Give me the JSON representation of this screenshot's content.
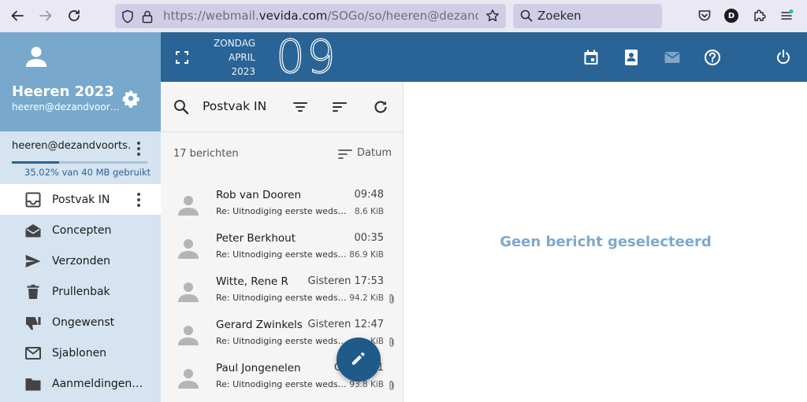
{
  "browser": {
    "url_prefix": "https://webmail.",
    "url_domain": "vevida.com",
    "url_suffix": "/SOGo/so/heeren@dezandvoortse.n",
    "search_placeholder": "Zoeken",
    "profile_initial": "D"
  },
  "header": {
    "weekday": "ZONDAG",
    "month": "APRIL",
    "year": "2023",
    "day": "09"
  },
  "sidebar": {
    "user_name": "Heeren 2023",
    "user_email": "heeren@dezandvoor…",
    "account": "heeren@dezandvoorts…",
    "quota_fraction": 0.3502,
    "quota_text": "35.02% van 40 MB gebruikt",
    "folders": [
      {
        "label": "Postvak IN",
        "icon": "inbox-icon"
      },
      {
        "label": "Concepten",
        "icon": "drafts-icon"
      },
      {
        "label": "Verzonden",
        "icon": "send-icon"
      },
      {
        "label": "Prullenbak",
        "icon": "trash-icon"
      },
      {
        "label": "Ongewenst",
        "icon": "thumb-down-icon"
      },
      {
        "label": "Sjablonen",
        "icon": "mail-icon"
      },
      {
        "label": "Aanmeldingen…",
        "icon": "folder-icon"
      }
    ]
  },
  "list": {
    "title": "Postvak IN",
    "count": "17 berichten",
    "sort_label": "Datum",
    "messages": [
      {
        "sender": "Rob van Dooren",
        "time": "09:48",
        "subject": "Re: Uitnodiging eerste wedstr…",
        "size": "8.6 KiB",
        "attachment": false
      },
      {
        "sender": "Peter Berkhout",
        "time": "00:35",
        "subject": "Re: Uitnodiging eerste wedst…",
        "size": "86.9 KiB",
        "attachment": false
      },
      {
        "sender": "Witte, Rene R",
        "time": "Gisteren 17:53",
        "subject": "Re: Uitnodiging eerste wedst…",
        "size": "94.2 KiB",
        "attachment": true
      },
      {
        "sender": "Gerard Zwinkels",
        "time": "Gisteren 12:47",
        "subject": "Re: Uitnodiging eerste wedst…",
        "size": "…KiB",
        "attachment": true
      },
      {
        "sender": "Paul Jongenelen",
        "time": "Giste…21",
        "subject": "Re: Uitnodiging eerste wedst…",
        "size": "93.8 KiB",
        "attachment": true
      }
    ]
  },
  "reading": {
    "empty_text": "Geen bericht geselecteerd"
  },
  "colors": {
    "accent": "#2a6496",
    "sidebar_top": "#78a9cd",
    "sidebar_bg": "#d5e4f0",
    "empty_text": "#7ea9cc"
  }
}
